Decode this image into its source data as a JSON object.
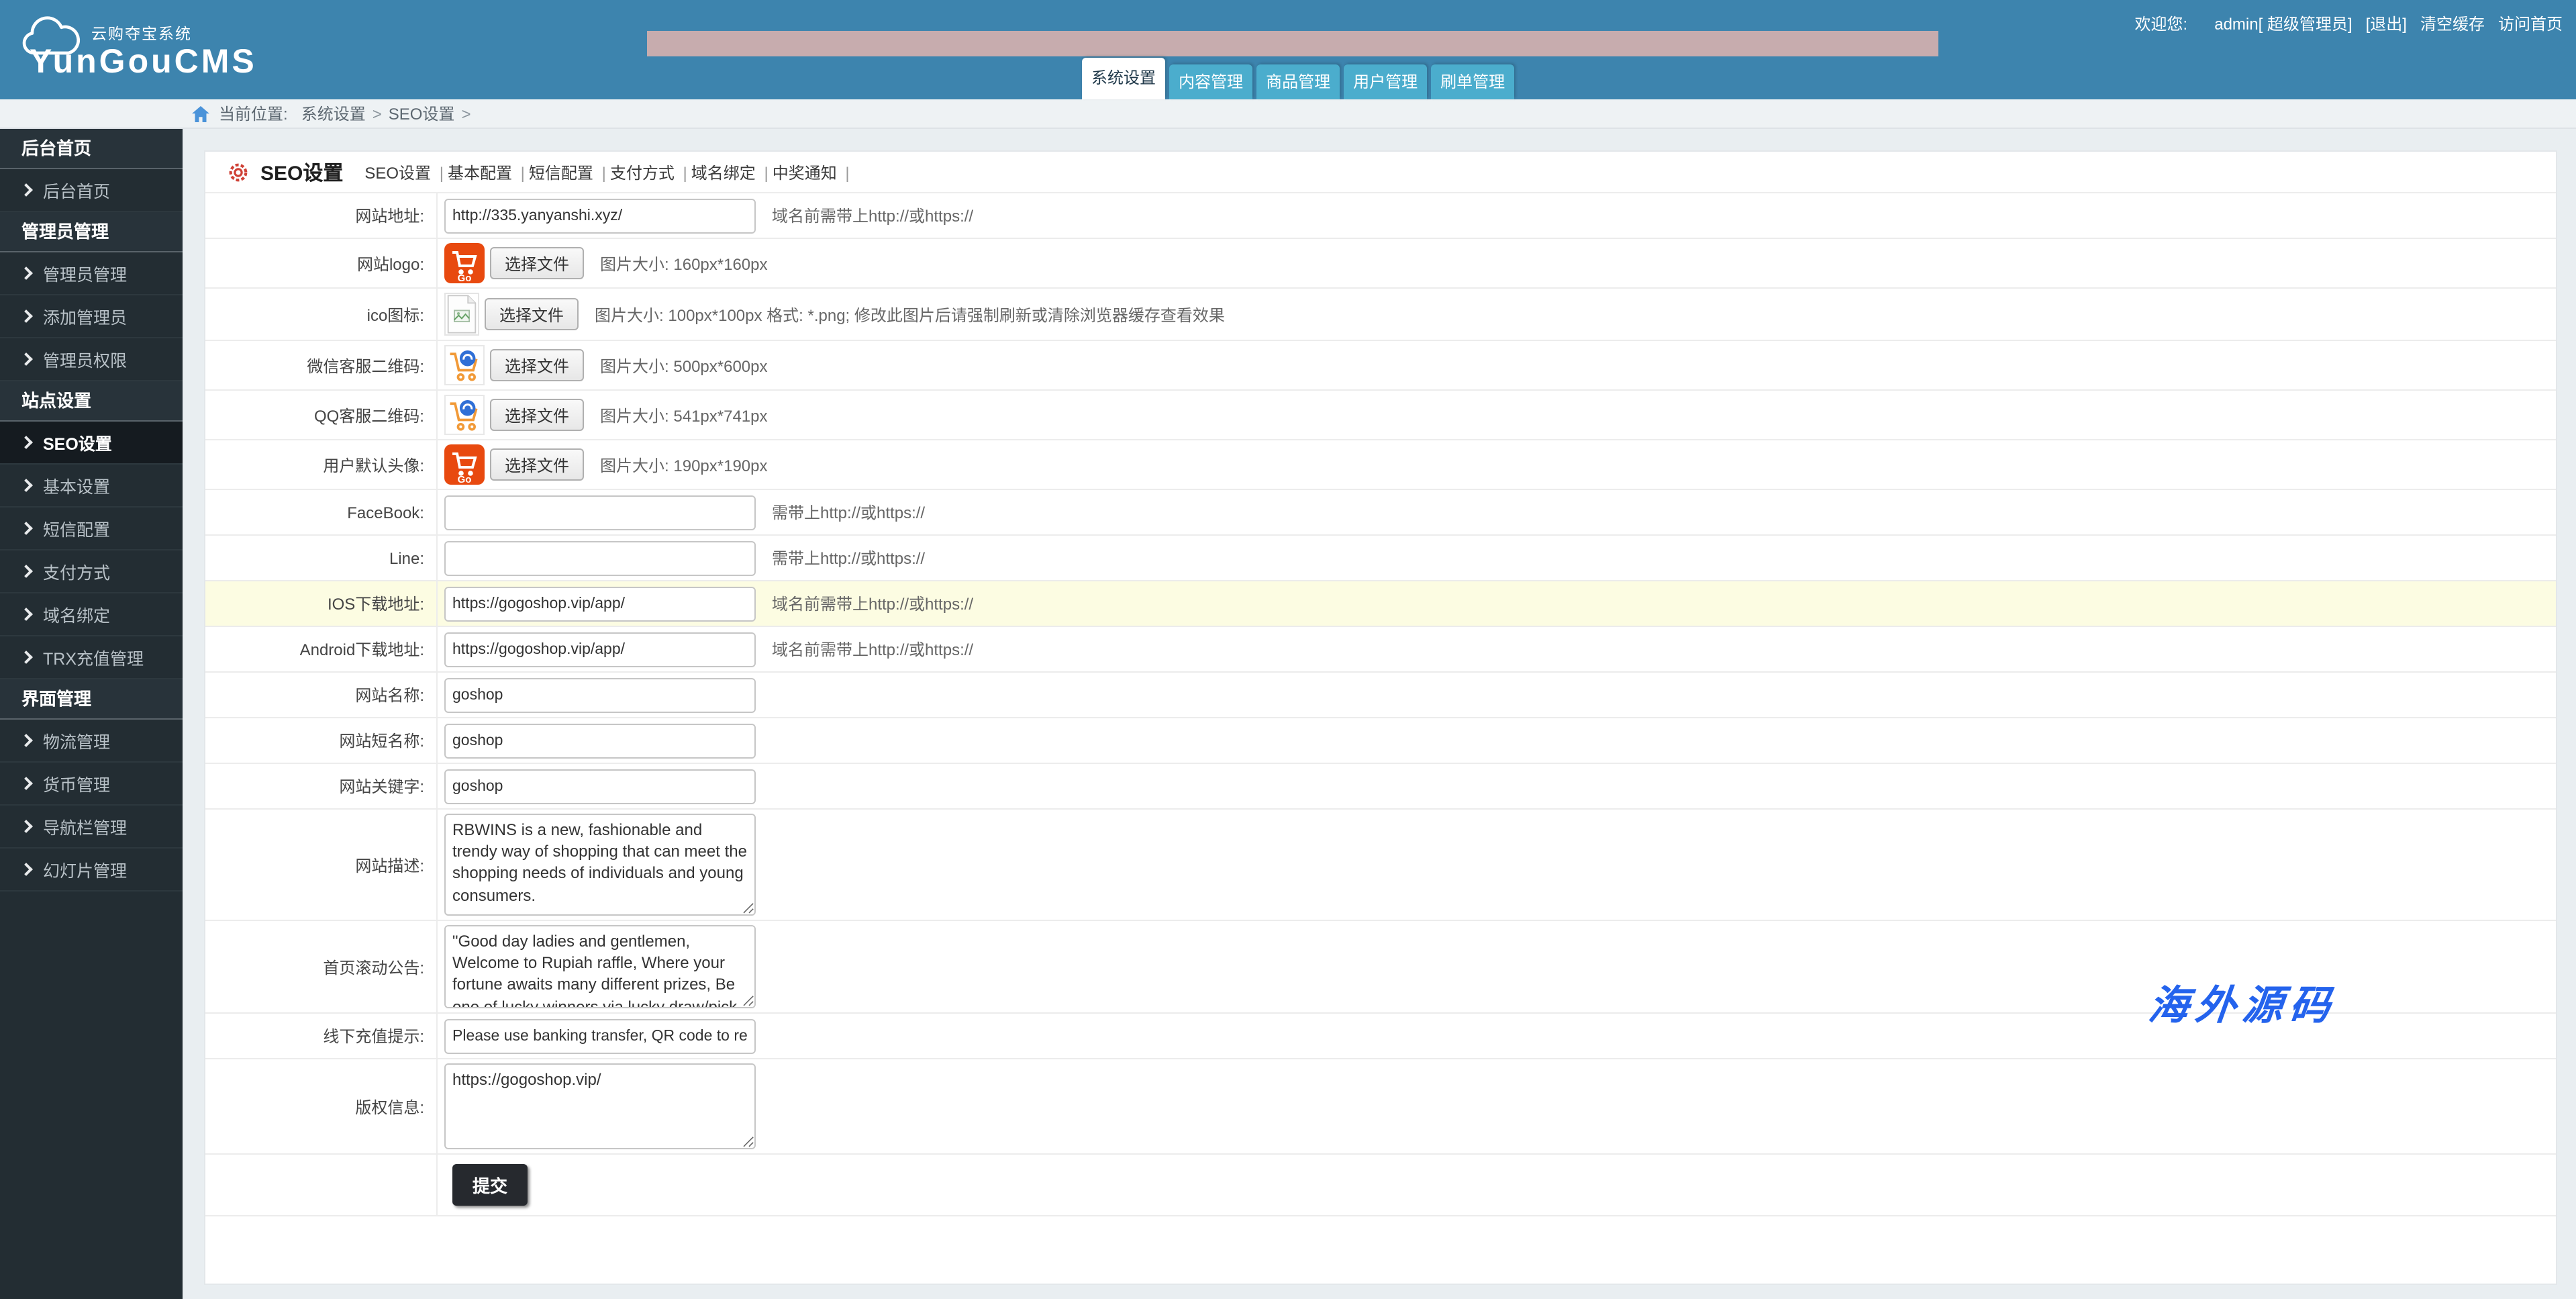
{
  "header": {
    "logo_subtitle": "云购夺宝系统",
    "logo_title": "YunGouCMS",
    "welcome_label": "欢迎您:",
    "user": "admin[ 超级管理员]",
    "logout": "[退出]",
    "clear_cache": "清空缓存",
    "visit_home": "访问首页",
    "tabs": [
      {
        "label": "系统设置",
        "active": true
      },
      {
        "label": "内容管理",
        "active": false
      },
      {
        "label": "商品管理",
        "active": false
      },
      {
        "label": "用户管理",
        "active": false
      },
      {
        "label": "刷单管理",
        "active": false
      }
    ]
  },
  "breadcrumb": {
    "label": "当前位置:",
    "items": [
      {
        "label": "系统设置"
      },
      {
        "label": "SEO设置"
      }
    ],
    "separator": ">"
  },
  "sidebar": {
    "sections": [
      {
        "title": "后台首页",
        "items": [
          {
            "label": "后台首页"
          }
        ]
      },
      {
        "title": "管理员管理",
        "items": [
          {
            "label": "管理员管理"
          },
          {
            "label": "添加管理员"
          },
          {
            "label": "管理员权限"
          }
        ]
      },
      {
        "title": "站点设置",
        "items": [
          {
            "label": "SEO设置",
            "active": true
          },
          {
            "label": "基本设置"
          },
          {
            "label": "短信配置"
          },
          {
            "label": "支付方式"
          },
          {
            "label": "域名绑定"
          },
          {
            "label": "TRX充值管理"
          }
        ]
      },
      {
        "title": "界面管理",
        "items": [
          {
            "label": "物流管理"
          },
          {
            "label": "货币管理"
          },
          {
            "label": "导航栏管理"
          },
          {
            "label": "幻灯片管理"
          }
        ]
      }
    ]
  },
  "panel": {
    "title": "SEO设置",
    "links": [
      {
        "label": "SEO设置"
      },
      {
        "label": "基本配置"
      },
      {
        "label": "短信配置"
      },
      {
        "label": "支付方式"
      },
      {
        "label": "域名绑定"
      },
      {
        "label": "中奖通知"
      }
    ],
    "file_button_label": "选择文件",
    "rows": [
      {
        "label": "网站地址:",
        "value": "http://335.yanyanshi.xyz/",
        "hint": "域名前需带上http://或https://"
      },
      {
        "label": "网站logo:",
        "hint": "图片大小: 160px*160px"
      },
      {
        "label": "ico图标:",
        "hint": "图片大小: 100px*100px 格式: *.png; 修改此图片后请强制刷新或清除浏览器缓存查看效果"
      },
      {
        "label": "微信客服二维码:",
        "hint": "图片大小: 500px*600px"
      },
      {
        "label": "QQ客服二维码:",
        "hint": "图片大小: 541px*741px"
      },
      {
        "label": "用户默认头像:",
        "hint": "图片大小: 190px*190px"
      },
      {
        "label": "FaceBook:",
        "value": "",
        "hint": "需带上http://或https://"
      },
      {
        "label": "Line:",
        "value": "",
        "hint": "需带上http://或https://"
      },
      {
        "label": "IOS下载地址:",
        "value": "https://gogoshop.vip/app/",
        "hint": "域名前需带上http://或https://"
      },
      {
        "label": "Android下载地址:",
        "value": "https://gogoshop.vip/app/",
        "hint": "域名前需带上http://或https://"
      },
      {
        "label": "网站名称:",
        "value": "goshop"
      },
      {
        "label": "网站短名称:",
        "value": "goshop"
      },
      {
        "label": "网站关键字:",
        "value": "goshop"
      },
      {
        "label": "网站描述:",
        "value": "RBWINS is a new, fashionable and trendy way of shopping that can meet the shopping needs of individuals and young consumers."
      },
      {
        "label": "首页滚动公告:",
        "value": "\"Good day ladies and gentlemen, Welcome to Rupiah raffle, Where your fortune awaits many different prizes, Be one of lucky winners via lucky draw/pick and claim as many prizes, and many more. May you have a great and wonderful day a"
      },
      {
        "label": "线下充值提示:",
        "value": "Please use banking transfer, QR code to recharge"
      },
      {
        "label": "版权信息:",
        "value": "https://gogoshop.vip/"
      },
      {
        "label": "提交"
      }
    ]
  },
  "watermark": "海外源码",
  "colors": {
    "header_blue": "#3d84ae",
    "tab_teal": "#4badcd",
    "banner_pink": "#c7acae",
    "sidebar_dark": "#232d33",
    "sidebar_active": "#151b20",
    "highlight_yellow": "#fcfce2",
    "watermark_blue": "#2463ed",
    "logo_orange": "#e8490f",
    "gear_red": "#cf4136",
    "submit_dark": "#26292e"
  }
}
